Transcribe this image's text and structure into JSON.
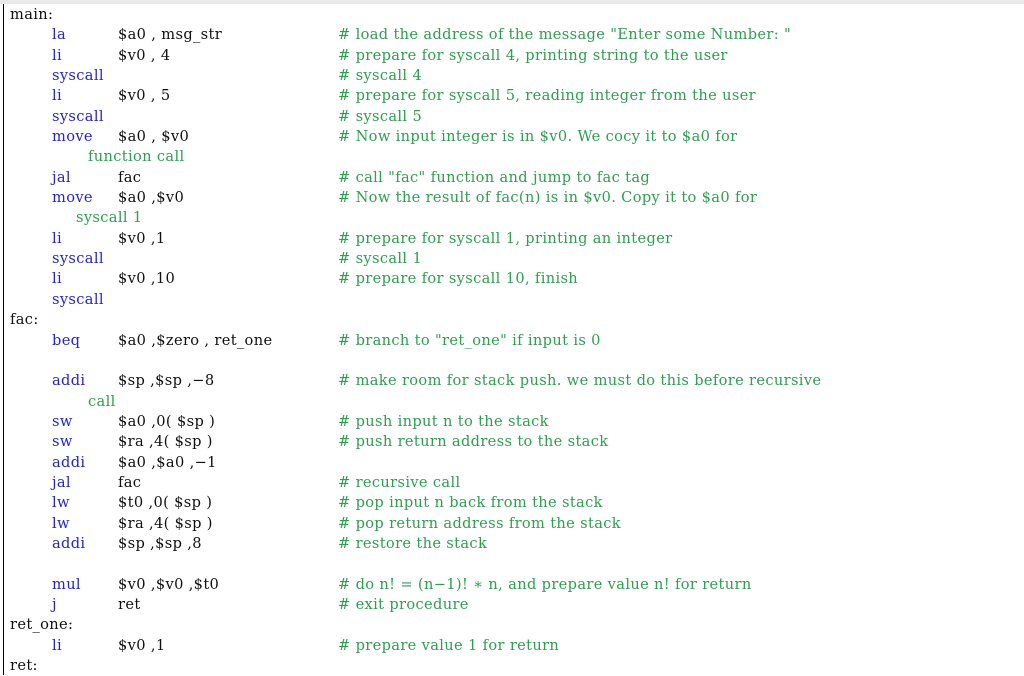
{
  "listing": {
    "language": "MIPS assembly",
    "colors": {
      "keyword": "#2222dd",
      "comment": "#2e9e4f",
      "text": "#101010",
      "background": "#ffffff",
      "rule": "#000000",
      "top_band": "#e9e9e9"
    },
    "lines": [
      {
        "kind": "label",
        "label": "main:"
      },
      {
        "kind": "instr",
        "mnemonic": "la",
        "operands": "$a0 ,  msg_str",
        "comment": "# load the address of the message \"Enter some Number: \""
      },
      {
        "kind": "instr",
        "mnemonic": "li",
        "operands": "$v0 ,  4",
        "comment": "# prepare for syscall 4, printing string to the user"
      },
      {
        "kind": "instr",
        "mnemonic": "syscall",
        "operands": "",
        "comment": "# syscall 4"
      },
      {
        "kind": "instr",
        "mnemonic": "li",
        "operands": "$v0 ,  5",
        "comment": "# prepare for syscall 5, reading integer from the user"
      },
      {
        "kind": "instr",
        "mnemonic": "syscall",
        "operands": "",
        "comment": "# syscall 5"
      },
      {
        "kind": "instr",
        "mnemonic": "move",
        "operands": "$a0 ,  $v0",
        "comment": "# Now input integer is in $v0. We cocy it to $a0 for"
      },
      {
        "kind": "cont",
        "indent": 84,
        "text": "function  call"
      },
      {
        "kind": "instr",
        "mnemonic": "jal",
        "operands": "fac",
        "comment": "# call \"fac\" function and jump to fac tag"
      },
      {
        "kind": "instr",
        "mnemonic": "move",
        "operands": "$a0 ,$v0",
        "comment": "# Now the result of fac(n) is in $v0. Copy it to $a0 for"
      },
      {
        "kind": "cont",
        "indent": 72,
        "text": "syscall 1"
      },
      {
        "kind": "instr",
        "mnemonic": "li",
        "operands": "$v0 ,1",
        "comment": "# prepare for syscall 1, printing an integer"
      },
      {
        "kind": "instr",
        "mnemonic": "syscall",
        "operands": "",
        "comment": "# syscall 1"
      },
      {
        "kind": "instr",
        "mnemonic": "li",
        "operands": "$v0 ,10",
        "comment": "# prepare for syscall 10, finish"
      },
      {
        "kind": "instr",
        "mnemonic": "syscall",
        "operands": "",
        "comment": ""
      },
      {
        "kind": "label",
        "label": "fac:"
      },
      {
        "kind": "instr",
        "mnemonic": "beq",
        "operands": "$a0 ,$zero , ret_one",
        "comment": "# branch to \"ret_one\" if input is 0"
      },
      {
        "kind": "blank"
      },
      {
        "kind": "instr",
        "mnemonic": "addi",
        "operands": "$sp ,$sp ,−8",
        "comment": "# make room for stack push. we must do this before recursive"
      },
      {
        "kind": "cont",
        "indent": 84,
        "text": "call"
      },
      {
        "kind": "instr",
        "mnemonic": "sw",
        "operands": "$a0 ,0( $sp )",
        "comment": "# push input n to the stack"
      },
      {
        "kind": "instr",
        "mnemonic": "sw",
        "operands": "$ra ,4( $sp )",
        "comment": "# push return address to the stack"
      },
      {
        "kind": "instr",
        "mnemonic": "addi",
        "operands": "$a0 ,$a0 ,−1",
        "comment": ""
      },
      {
        "kind": "instr",
        "mnemonic": "jal",
        "operands": "fac",
        "comment": "# recursive call"
      },
      {
        "kind": "instr",
        "mnemonic": "lw",
        "operands": "$t0 ,0( $sp )",
        "comment": "# pop input n back from the stack"
      },
      {
        "kind": "instr",
        "mnemonic": "lw",
        "operands": "$ra ,4( $sp )",
        "comment": "# pop return address from the stack"
      },
      {
        "kind": "instr",
        "mnemonic": "addi",
        "operands": "$sp ,$sp ,8",
        "comment": "# restore the stack"
      },
      {
        "kind": "blank"
      },
      {
        "kind": "instr",
        "mnemonic": "mul",
        "operands": "$v0 ,$v0 ,$t0",
        "comment": "# do n! = (n−1)! ∗ n, and prepare value n! for return"
      },
      {
        "kind": "instr",
        "mnemonic": "j",
        "operands": "ret",
        "comment": "# exit procedure"
      },
      {
        "kind": "label",
        "label": "ret_one:"
      },
      {
        "kind": "instr",
        "mnemonic": "li",
        "operands": "$v0 ,1",
        "comment": "# prepare value 1 for return"
      },
      {
        "kind": "label",
        "label": "ret:"
      }
    ]
  }
}
